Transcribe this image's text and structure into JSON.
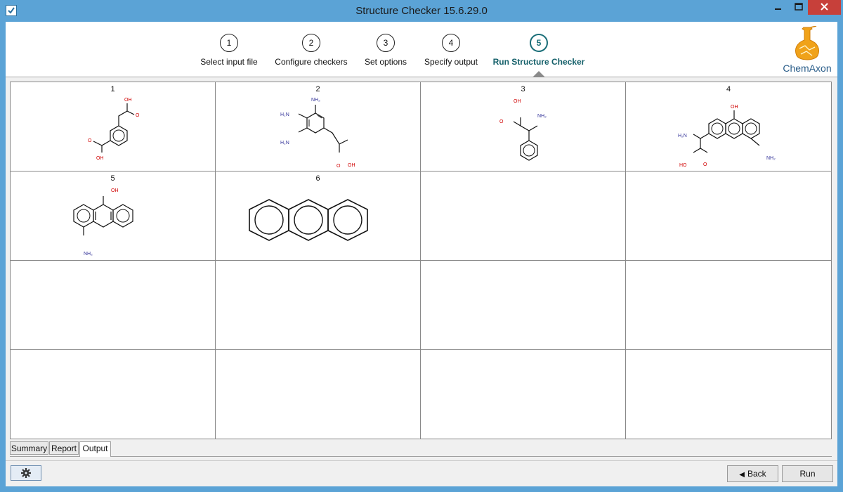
{
  "window": {
    "title": "Structure Checker 15.6.29.0",
    "minimize_icon": "minimize-icon",
    "maximize_icon": "maximize-icon",
    "close_icon": "close-icon"
  },
  "wizard": {
    "steps": [
      {
        "number": "1",
        "label": "Select input file"
      },
      {
        "number": "2",
        "label": "Configure checkers"
      },
      {
        "number": "3",
        "label": "Set options"
      },
      {
        "number": "4",
        "label": "Specify output"
      },
      {
        "number": "5",
        "label": "Run Structure Checker"
      }
    ],
    "active_step": 5,
    "accent_color": "#1a6e78"
  },
  "logo": {
    "text": "ChemAxon",
    "icon": "flask-logo-icon",
    "color": "#f0a21a"
  },
  "grid": {
    "cells": [
      {
        "number": "1",
        "atoms": [
          "OH",
          "O",
          "O",
          "OH"
        ]
      },
      {
        "number": "2",
        "atoms": [
          "NH₂",
          "H₂N",
          "H₂N",
          "O",
          "OH"
        ]
      },
      {
        "number": "3",
        "atoms": [
          "OH",
          "NH₂",
          "O"
        ]
      },
      {
        "number": "4",
        "atoms": [
          "OH",
          "H₂N",
          "HO",
          "O",
          "NH₂"
        ]
      },
      {
        "number": "5",
        "atoms": [
          "OH",
          "NH₂"
        ]
      },
      {
        "number": "6",
        "atoms": []
      }
    ]
  },
  "tabs": [
    {
      "label": "Summary"
    },
    {
      "label": "Report"
    },
    {
      "label": "Output"
    }
  ],
  "active_tab": "Output",
  "footer": {
    "settings_icon": "gear-icon",
    "back_label": "Back",
    "back_icon": "back-arrow-icon",
    "run_label": "Run"
  }
}
